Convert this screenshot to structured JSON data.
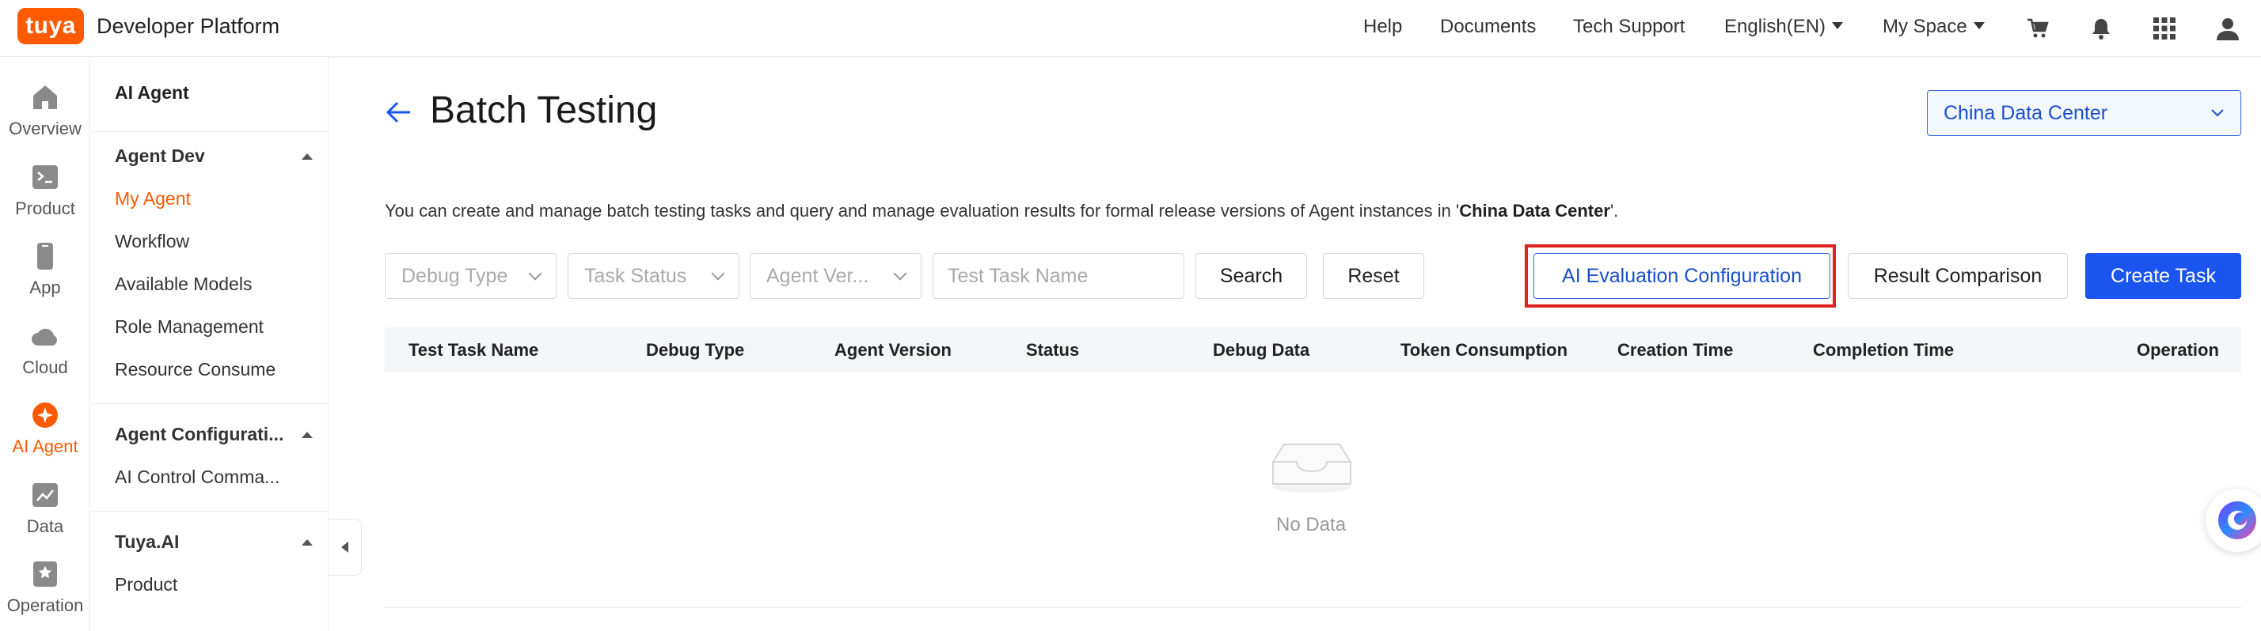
{
  "brand": {
    "logo_text": "tuya",
    "title": "Developer Platform",
    "accent": "#ff5a00"
  },
  "topnav": {
    "help": "Help",
    "documents": "Documents",
    "tech_support": "Tech Support",
    "language": "English(EN)",
    "my_space": "My Space",
    "icons": [
      "cart-icon",
      "bell-icon",
      "apps-grid-icon",
      "user-icon"
    ]
  },
  "rail": {
    "items": [
      {
        "label": "Overview",
        "icon": "home-icon"
      },
      {
        "label": "Product",
        "icon": "terminal-icon"
      },
      {
        "label": "App",
        "icon": "phone-icon"
      },
      {
        "label": "Cloud",
        "icon": "cloud-icon"
      },
      {
        "label": "AI Agent",
        "icon": "ai-agent-icon",
        "active": true
      },
      {
        "label": "Data",
        "icon": "chart-icon"
      },
      {
        "label": "Operation",
        "icon": "bookmark-icon"
      }
    ]
  },
  "sidenav": {
    "title": "AI Agent",
    "groups": [
      {
        "label": "Agent Dev",
        "items": [
          "My Agent",
          "Workflow",
          "Available Models",
          "Role Management",
          "Resource Consume"
        ]
      },
      {
        "label": "Agent Configurati...",
        "items": [
          "AI Control Comma..."
        ]
      },
      {
        "label": "Tuya.AI",
        "items": [
          "Product"
        ]
      }
    ],
    "active_item": "My Agent"
  },
  "page": {
    "title": "Batch Testing",
    "data_center": "China Data Center",
    "description_prefix": "You can create and manage batch testing tasks and query and manage evaluation results for formal release versions of Agent instances in '",
    "description_bold": "China Data Center",
    "description_suffix": "'."
  },
  "filters": {
    "debug_type_placeholder": "Debug Type",
    "task_status_placeholder": "Task Status",
    "agent_version_placeholder": "Agent Ver...",
    "task_name_placeholder": "Test Task Name",
    "search_label": "Search",
    "reset_label": "Reset"
  },
  "actions": {
    "ai_eval_config": "AI Evaluation Configuration",
    "result_comparison": "Result Comparison",
    "create_task": "Create Task",
    "primary_color": "#1a55f0",
    "highlight_color": "#e02020"
  },
  "table": {
    "columns": [
      "Test Task Name",
      "Debug Type",
      "Agent Version",
      "Status",
      "Debug Data",
      "Token Consumption",
      "Creation Time",
      "Completion Time",
      "Operation"
    ],
    "rows": [],
    "empty_text": "No Data"
  }
}
